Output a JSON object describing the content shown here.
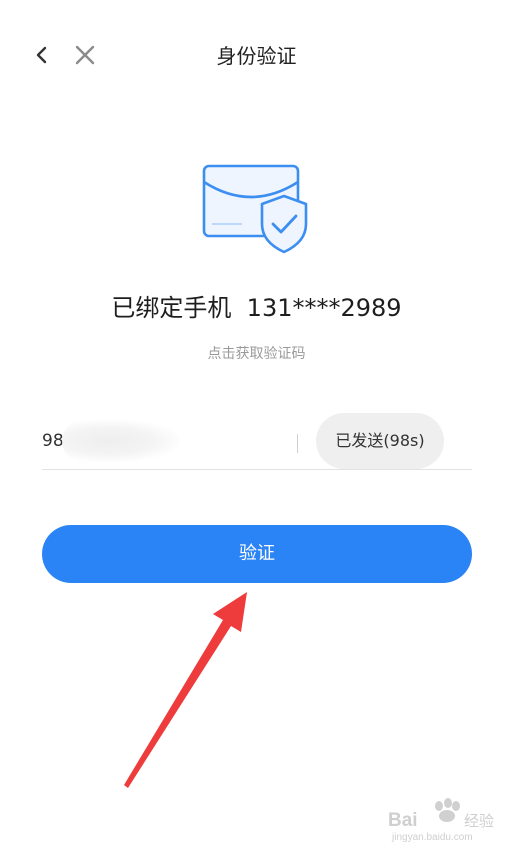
{
  "header": {
    "title": "身份验证",
    "back_icon": "chevron-left-icon",
    "close_icon": "close-icon"
  },
  "hero": {
    "icon": "mail-shield-check-icon",
    "bound_phone": "已绑定手机  131****2989",
    "hint": "点击获取验证码"
  },
  "code_field": {
    "value": "98",
    "send_button_label": "已发送(98s)"
  },
  "verify_button": {
    "label": "验证"
  },
  "colors": {
    "primary": "#2b84f5",
    "send_button_bg": "#efefef",
    "annotation": "#ee3b3b",
    "icon_blue": "#3c8ef0"
  },
  "watermark": {
    "text": "Baidu经验",
    "subtext": "jingyan.baidu.com"
  }
}
